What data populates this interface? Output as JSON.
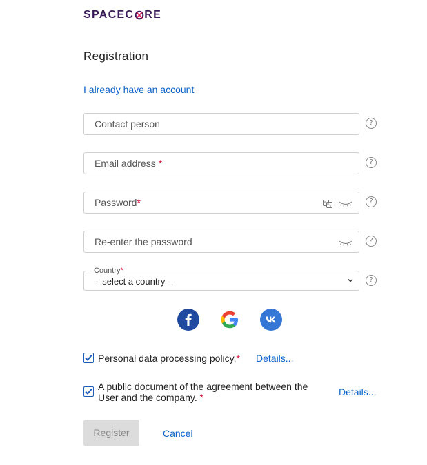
{
  "brand": {
    "logo_prefix": "SPACEC",
    "logo_suffix": "RE"
  },
  "title": "Registration",
  "already_link": "I already have an account",
  "fields": {
    "contact": {
      "placeholder": "Contact person"
    },
    "email": {
      "placeholder": "Email address",
      "required_mark": "*"
    },
    "password": {
      "placeholder": "Password",
      "required_mark": "*"
    },
    "reenter": {
      "placeholder": "Re-enter the password"
    },
    "country": {
      "label": "Country",
      "required_mark": "*",
      "value": "-- select a country --"
    }
  },
  "help_glyph": "?",
  "social": [
    "facebook",
    "google",
    "vk"
  ],
  "consents": [
    {
      "text": "Personal data processing policy.",
      "required_mark": "*",
      "details": "Details...",
      "checked": true
    },
    {
      "text_line1": "A public document of the agreement between the",
      "text_line2": "User and the company.",
      "required_mark": "*",
      "details": "Details...",
      "checked": true
    }
  ],
  "buttons": {
    "register": "Register",
    "cancel": "Cancel"
  },
  "colors": {
    "brand": "#3b1c5a",
    "link": "#0a63c9",
    "required": "#d0103a",
    "checkbox": "#1d5fb8"
  }
}
